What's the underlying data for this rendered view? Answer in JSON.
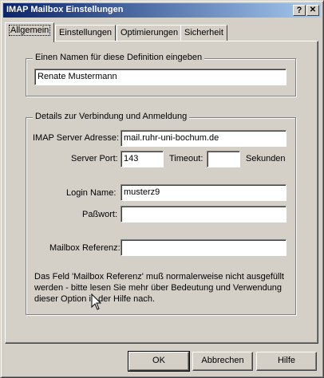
{
  "window": {
    "title": "IMAP Mailbox Einstellungen",
    "help_glyph": "?",
    "close_glyph": "✕"
  },
  "tabs": [
    {
      "label": "Allgemein",
      "active": true
    },
    {
      "label": "Einstellungen",
      "active": false
    },
    {
      "label": "Optimierungen",
      "active": false
    },
    {
      "label": "Sicherheit",
      "active": false
    }
  ],
  "name_group": {
    "legend": "Einen Namen für diese Definition eingeben",
    "value": "Renate Mustermann"
  },
  "conn_group": {
    "legend": "Details zur Verbindung und Anmeldung",
    "server_label": "IMAP Server Adresse:",
    "server_value": "mail.ruhr-uni-bochum.de",
    "port_label": "Server Port:",
    "port_value": "143",
    "timeout_label": "Timeout:",
    "timeout_value": "",
    "timeout_unit": "Sekunden",
    "login_label": "Login Name:",
    "login_value": "musterz9",
    "password_label": "Paßwort:",
    "password_value": "",
    "mailbox_label": "Mailbox Referenz:",
    "mailbox_value": "",
    "note": "Das Feld 'Mailbox Referenz' muß normalerweise nicht ausgefüllt werden - bitte lesen Sie mehr über Bedeutung und Verwendung dieser Option in der Hilfe nach."
  },
  "buttons": {
    "ok": "OK",
    "cancel": "Abbrechen",
    "help": "Hilfe"
  }
}
